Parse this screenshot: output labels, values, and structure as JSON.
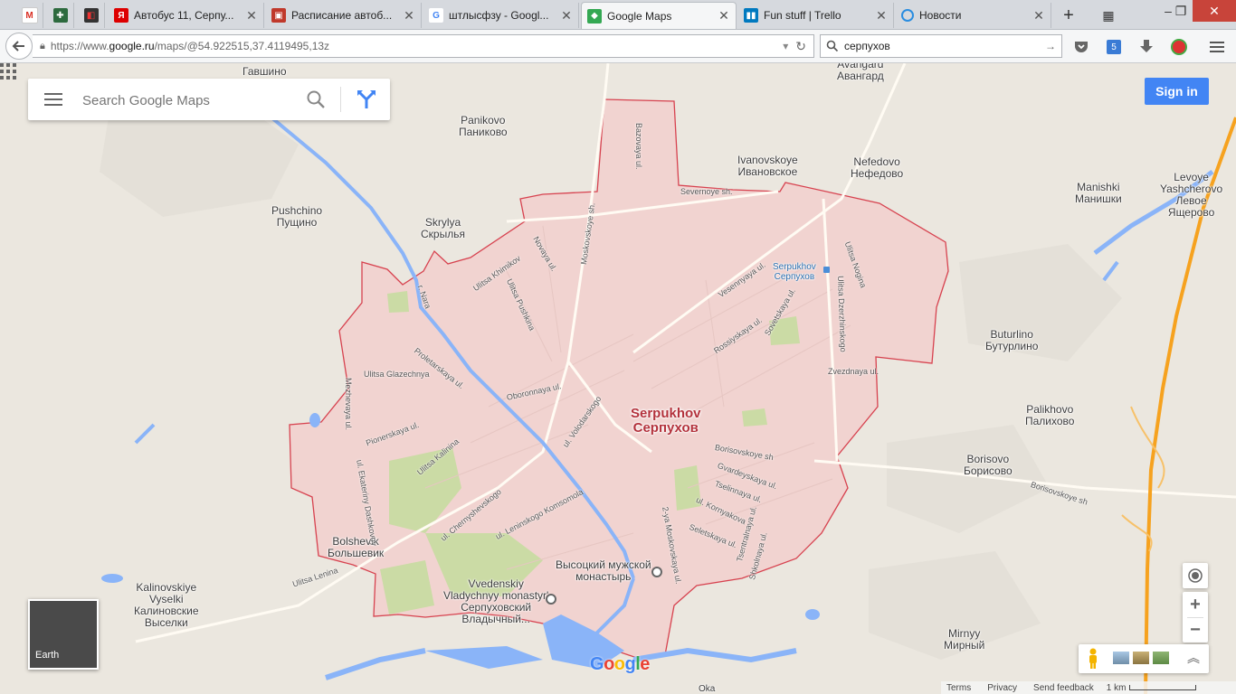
{
  "browser": {
    "tabs": [
      {
        "label": "",
        "icon": "gmail-icon",
        "pinned": true
      },
      {
        "label": "",
        "icon": "tool-icon",
        "pinned": true
      },
      {
        "label": "",
        "icon": "app-icon",
        "pinned": true
      },
      {
        "label": "Автобус 11, Серпу...",
        "icon": "yandex-icon"
      },
      {
        "label": "Расписание автоб...",
        "icon": "bus-icon"
      },
      {
        "label": "штлысфзу - Googl...",
        "icon": "google-icon"
      },
      {
        "label": "Google Maps",
        "icon": "maps-icon",
        "active": true
      },
      {
        "label": "Fun stuff | Trello",
        "icon": "trello-icon"
      },
      {
        "label": "Новости",
        "icon": "loading-icon"
      }
    ],
    "url_prefix": "https://www.",
    "url_domain": "google.ru",
    "url_suffix": "/maps/@54.922515,37.4119495,13z",
    "search_value": "серпухов",
    "toolbar_badge": "5"
  },
  "maps": {
    "search_placeholder": "Search Google Maps",
    "signin_label": "Sign in",
    "earth_label": "Earth",
    "footer": {
      "terms": "Terms",
      "privacy": "Privacy",
      "feedback": "Send feedback",
      "scale": "1 km"
    },
    "city_label_en": "Serpukhov",
    "city_label_ru": "Серпухов",
    "places": [
      {
        "id": "gavshino",
        "text": "Гавшино"
      },
      {
        "id": "avangard",
        "text": "Avangard\nАвангард"
      },
      {
        "id": "panikovo",
        "text": "Panikovo\nПаниково"
      },
      {
        "id": "ivanovskoye",
        "text": "Ivanovskoye\nИвановское"
      },
      {
        "id": "nefedovo",
        "text": "Nefedovo\nНефедово"
      },
      {
        "id": "manishki",
        "text": "Manishki\nМанишки"
      },
      {
        "id": "levoye",
        "text": "Levoye\nYashcherovo\nЛевое\nЯщерово"
      },
      {
        "id": "pushchino",
        "text": "Pushchino\nПущино"
      },
      {
        "id": "skrylya",
        "text": "Skrylya\nСкрылья"
      },
      {
        "id": "buturlino",
        "text": "Buturlino\nБутурлино"
      },
      {
        "id": "palikhovo",
        "text": "Palikhovo\nПалихово"
      },
      {
        "id": "borisovo",
        "text": "Borisovo\nБорисово"
      },
      {
        "id": "bolshevik",
        "text": "Bolshevik\nБольшевик"
      },
      {
        "id": "kalinovskiye",
        "text": "Kalinovskiye\nVyselki\nКалиновские\nВыселки"
      },
      {
        "id": "mirnyy",
        "text": "Mirnyy\nМирный"
      },
      {
        "id": "monastery1",
        "text": "Высоцкий мужской\nмонастырь"
      },
      {
        "id": "monastery2",
        "text": "Vvedenskiy\nVladychnyy monastyr'\nСерпуховский\nВладычный..."
      },
      {
        "id": "station",
        "text": "Serpukhov\nСерпухов"
      },
      {
        "id": "oka",
        "text": "Oka"
      }
    ],
    "streets": [
      "Bazovaya ul.",
      "Severnoye sh.",
      "Moskovskoye sh.",
      "Novaya ul.",
      "Ulitsa Khimikov",
      "Ulitsa Pushkina",
      "Ulitsa Nogina",
      "Ulitsa Dzerzhinskogo",
      "Vesennyaya ul.",
      "Rossiyskaya ul.",
      "Sovetskaya ul.",
      "Zvezdnaya ul.",
      "Proletarskaya ul.",
      "Ulitsa Glazechnya",
      "Oboronnaya ul.",
      "Mezhevaya ul.",
      "ul. Volodarskogo",
      "Pionerskaya ul.",
      "Ulitsa Kalinina",
      "Borisovskoye sh",
      "Gvardeyskaya ul.",
      "Tselinnaya ul.",
      "ul. Kornyakova",
      "ul. Ekateriny Dashkovoy",
      "ul. Chernyshevskogo",
      "ul. Leninskogo Komsomola",
      "2-ya Moskovskaya ul.",
      "Seletskaya ul.",
      "Tsentralnaya ul.",
      "Shkolnaya ul.",
      "Ulitsa Lenina",
      "r. Nara",
      "Borisovskoye sh"
    ]
  }
}
